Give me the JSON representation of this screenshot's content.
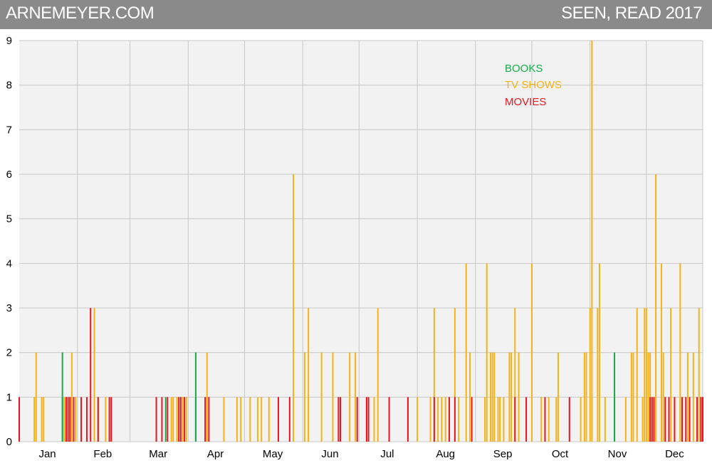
{
  "header": {
    "brand": "ARNEMEYER.COM",
    "title": "SEEN, READ 2017"
  },
  "colors": {
    "header_bg": "#8a8a8a",
    "plot_bg": "#f2f2f2",
    "grid": "#c8c8c8",
    "books": "#1aa84b",
    "tv_shows": "#f5b316",
    "movies": "#e8141e"
  },
  "chart_data": {
    "type": "bar",
    "title": "SEEN, READ 2017",
    "xlabel": "",
    "ylabel": "",
    "x_range_days": [
      1,
      365
    ],
    "ylim": [
      0,
      9
    ],
    "y_ticks": [
      0,
      1,
      2,
      3,
      4,
      5,
      6,
      7,
      8,
      9
    ],
    "grid": true,
    "legend_position": "top-center",
    "months": [
      "Jan",
      "Feb",
      "Mar",
      "Apr",
      "May",
      "Jun",
      "Jul",
      "Aug",
      "Sep",
      "Oct",
      "Nov",
      "Dec"
    ],
    "series": [
      {
        "name": "BOOKS",
        "color": "#1aa84b",
        "points": [
          [
            24,
            2
          ],
          [
            24,
            1
          ],
          [
            79,
            1
          ],
          [
            95,
            2
          ],
          [
            95,
            1
          ],
          [
            318,
            2
          ],
          [
            318,
            1
          ]
        ]
      },
      {
        "name": "TV SHOWS",
        "color": "#f5b316",
        "points": [
          [
            9,
            1
          ],
          [
            10,
            2
          ],
          [
            13,
            1
          ],
          [
            14,
            1
          ],
          [
            25,
            1
          ],
          [
            27,
            1
          ],
          [
            29,
            1
          ],
          [
            29,
            2
          ],
          [
            31,
            1
          ],
          [
            41,
            3
          ],
          [
            43,
            1
          ],
          [
            47,
            1
          ],
          [
            82,
            1
          ],
          [
            83,
            1
          ],
          [
            85,
            1
          ],
          [
            88,
            1
          ],
          [
            90,
            1
          ],
          [
            101,
            2
          ],
          [
            101,
            1
          ],
          [
            110,
            1
          ],
          [
            117,
            1
          ],
          [
            119,
            1
          ],
          [
            124,
            1
          ],
          [
            128,
            1
          ],
          [
            130,
            1
          ],
          [
            134,
            1
          ],
          [
            147,
            6
          ],
          [
            147,
            1
          ],
          [
            153,
            2
          ],
          [
            155,
            3
          ],
          [
            155,
            1
          ],
          [
            162,
            2
          ],
          [
            168,
            2
          ],
          [
            172,
            1
          ],
          [
            177,
            2
          ],
          [
            180,
            2
          ],
          [
            190,
            1
          ],
          [
            192,
            3
          ],
          [
            213,
            1
          ],
          [
            220,
            1
          ],
          [
            222,
            3
          ],
          [
            224,
            1
          ],
          [
            226,
            1
          ],
          [
            228,
            1
          ],
          [
            233,
            3
          ],
          [
            235,
            1
          ],
          [
            239,
            4
          ],
          [
            241,
            2
          ],
          [
            249,
            1
          ],
          [
            250,
            4
          ],
          [
            252,
            2
          ],
          [
            253,
            2
          ],
          [
            254,
            2
          ],
          [
            256,
            1
          ],
          [
            257,
            1
          ],
          [
            259,
            1
          ],
          [
            262,
            2
          ],
          [
            263,
            2
          ],
          [
            265,
            3
          ],
          [
            267,
            2
          ],
          [
            274,
            1
          ],
          [
            274,
            4
          ],
          [
            279,
            1
          ],
          [
            283,
            1
          ],
          [
            287,
            1
          ],
          [
            288,
            2
          ],
          [
            300,
            1
          ],
          [
            302,
            2
          ],
          [
            303,
            2
          ],
          [
            305,
            3
          ],
          [
            306,
            9
          ],
          [
            306,
            1
          ],
          [
            309,
            3
          ],
          [
            310,
            4
          ],
          [
            313,
            1
          ],
          [
            324,
            1
          ],
          [
            327,
            2
          ],
          [
            328,
            2
          ],
          [
            330,
            3
          ],
          [
            333,
            1
          ],
          [
            334,
            3
          ],
          [
            335,
            3
          ],
          [
            336,
            2
          ],
          [
            337,
            2
          ],
          [
            340,
            6
          ],
          [
            340,
            1
          ],
          [
            343,
            4
          ],
          [
            344,
            2
          ],
          [
            348,
            3
          ],
          [
            350,
            1
          ],
          [
            353,
            1
          ],
          [
            353,
            4
          ],
          [
            357,
            2
          ],
          [
            360,
            2
          ],
          [
            363,
            3
          ]
        ]
      },
      {
        "name": "MOVIES",
        "color": "#e8141e",
        "points": [
          [
            1,
            1
          ],
          [
            26,
            1
          ],
          [
            27,
            1
          ],
          [
            28,
            1
          ],
          [
            30,
            1
          ],
          [
            34,
            1
          ],
          [
            37,
            1
          ],
          [
            39,
            3
          ],
          [
            43,
            1
          ],
          [
            49,
            1
          ],
          [
            50,
            1
          ],
          [
            74,
            1
          ],
          [
            77,
            1
          ],
          [
            80,
            1
          ],
          [
            86,
            1
          ],
          [
            87,
            1
          ],
          [
            89,
            1
          ],
          [
            100,
            1
          ],
          [
            102,
            1
          ],
          [
            139,
            1
          ],
          [
            145,
            1
          ],
          [
            171,
            1
          ],
          [
            172,
            1
          ],
          [
            181,
            1
          ],
          [
            186,
            1
          ],
          [
            187,
            1
          ],
          [
            198,
            1
          ],
          [
            208,
            1
          ],
          [
            222,
            1
          ],
          [
            230,
            1
          ],
          [
            233,
            1
          ],
          [
            242,
            1
          ],
          [
            265,
            1
          ],
          [
            271,
            1
          ],
          [
            281,
            1
          ],
          [
            294,
            1
          ],
          [
            337,
            1
          ],
          [
            338,
            1
          ],
          [
            339,
            1
          ],
          [
            345,
            1
          ],
          [
            347,
            1
          ],
          [
            350,
            1
          ],
          [
            354,
            1
          ],
          [
            356,
            1
          ],
          [
            358,
            1
          ],
          [
            362,
            1
          ],
          [
            364,
            1
          ],
          [
            365,
            1
          ]
        ]
      }
    ]
  }
}
